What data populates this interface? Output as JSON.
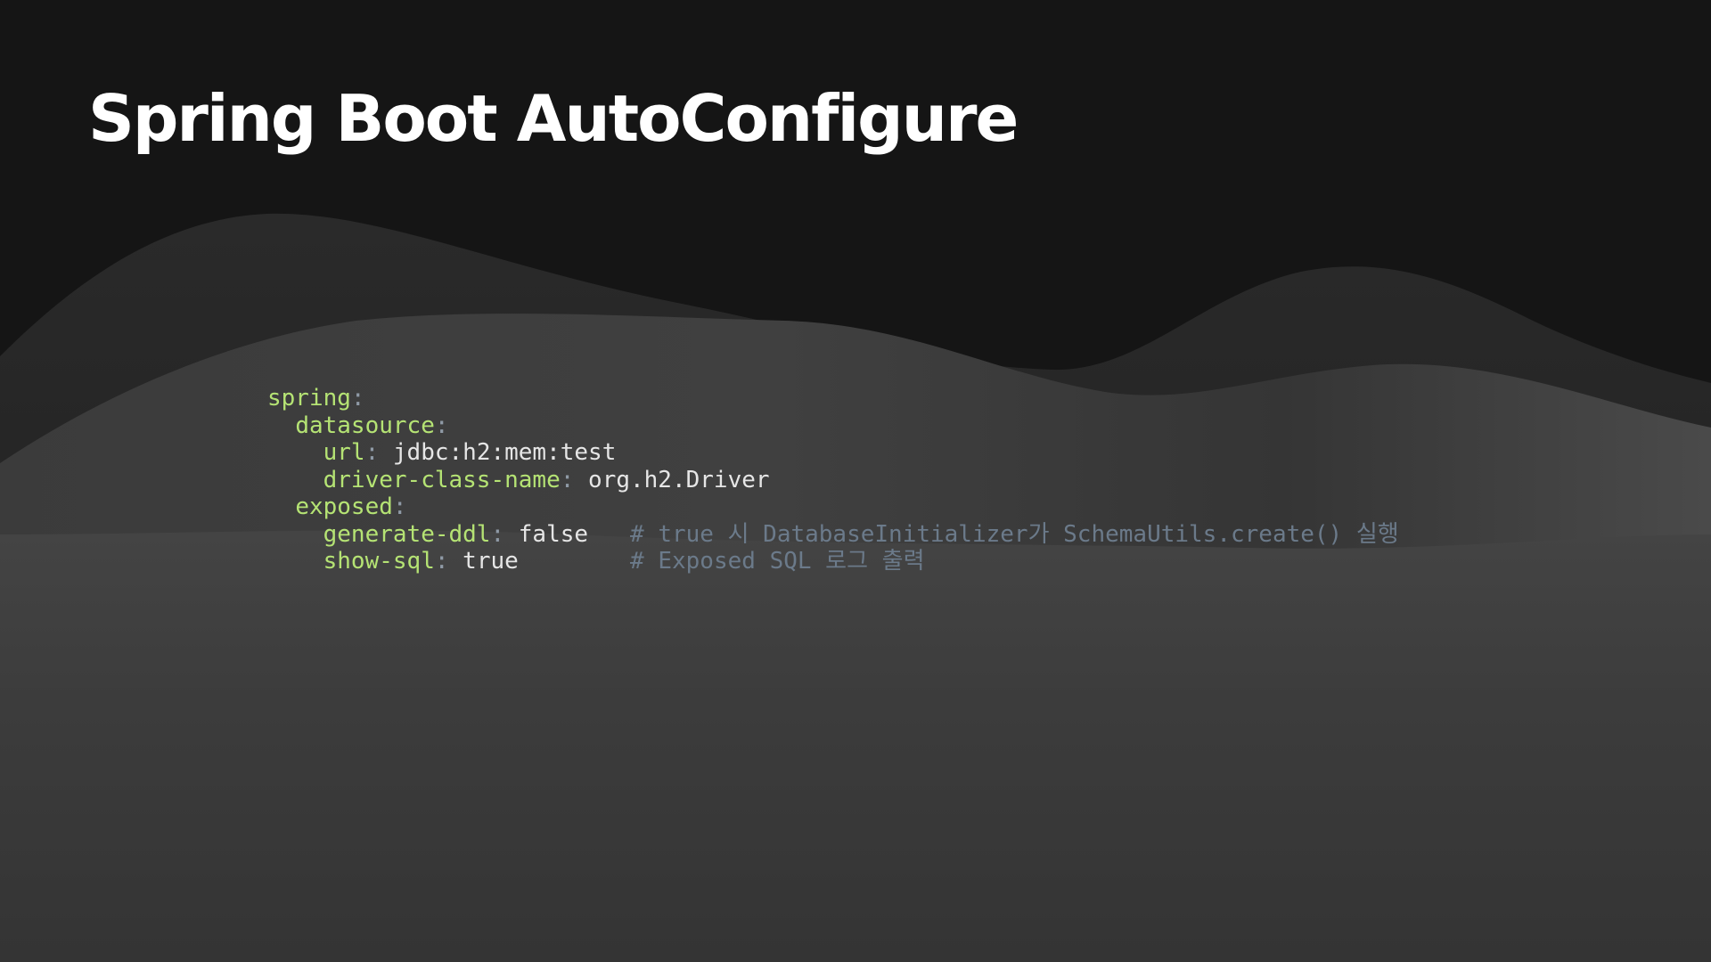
{
  "slide": {
    "title": "Spring Boot AutoConfigure"
  },
  "colors": {
    "background": "#151515",
    "key": "#b5e374",
    "value": "#e6e6e6",
    "comment": "#6b7a8a",
    "punctuation": "#8f9aa6"
  },
  "code": {
    "language": "yaml",
    "lines": [
      {
        "indent": "",
        "key": "spring",
        "sep": ":",
        "value": "",
        "pad": "",
        "comment": ""
      },
      {
        "indent": "  ",
        "key": "datasource",
        "sep": ":",
        "value": "",
        "pad": "",
        "comment": ""
      },
      {
        "indent": "    ",
        "key": "url",
        "sep": ":",
        "value": " jdbc:h2:mem:test",
        "pad": "",
        "comment": ""
      },
      {
        "indent": "    ",
        "key": "driver-class-name",
        "sep": ":",
        "value": " org.h2.Driver",
        "pad": "",
        "comment": ""
      },
      {
        "indent": "  ",
        "key": "exposed",
        "sep": ":",
        "value": "",
        "pad": "",
        "comment": ""
      },
      {
        "indent": "    ",
        "key": "generate-ddl",
        "sep": ":",
        "value": " false",
        "pad": "   ",
        "comment": "# true 시 DatabaseInitializer가 SchemaUtils.create() 실행"
      },
      {
        "indent": "    ",
        "key": "show-sql",
        "sep": ":",
        "value": " true",
        "pad": "        ",
        "comment": "# Exposed SQL 로그 출력"
      }
    ]
  }
}
